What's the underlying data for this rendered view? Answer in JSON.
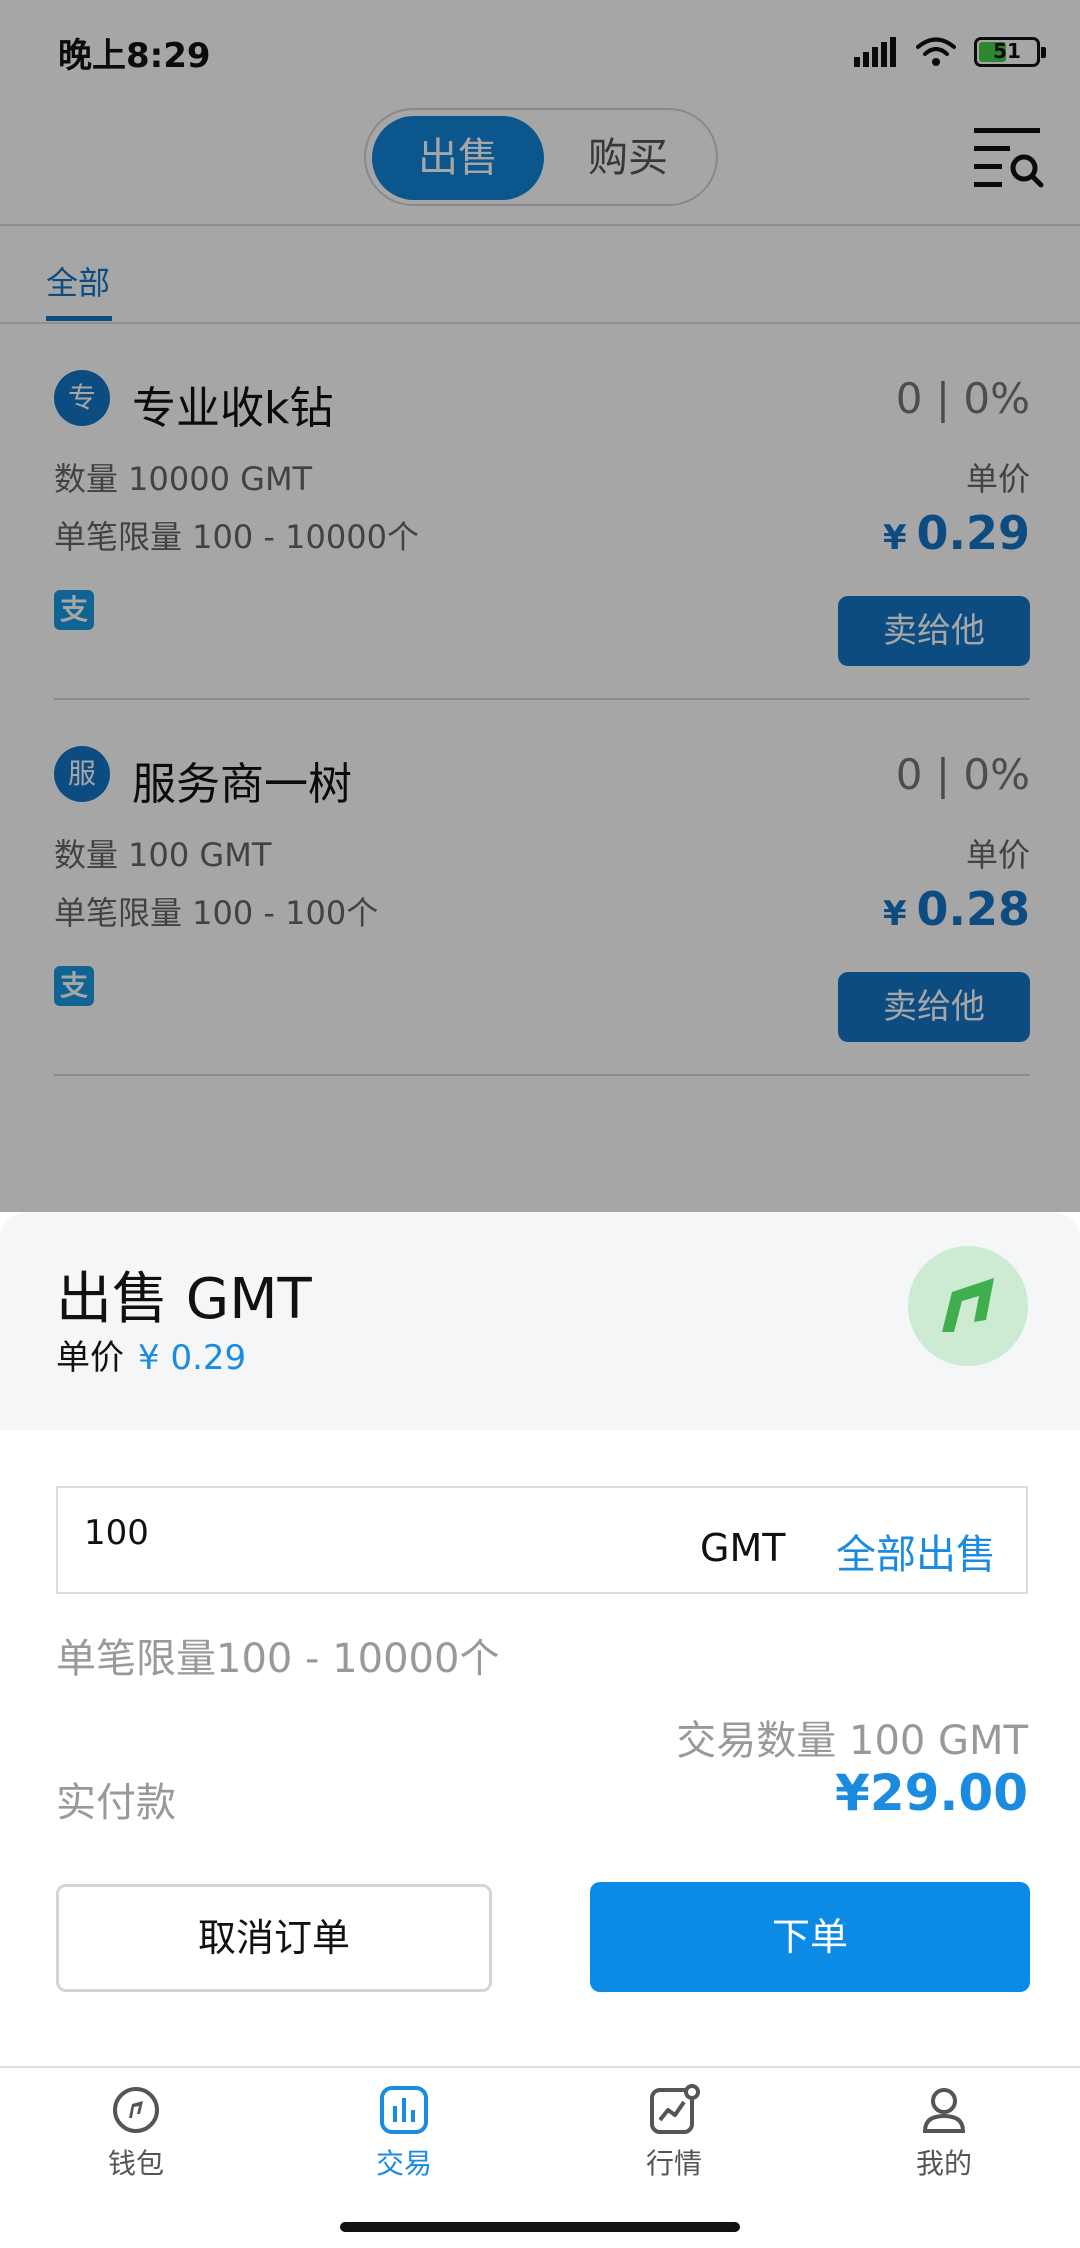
{
  "status_bar": {
    "time": "晚上8:29",
    "battery": "51",
    "battery_level": 0.51
  },
  "header": {
    "tabs": [
      "出售",
      "购买"
    ],
    "active_tab": "出售"
  },
  "filter_tabs": [
    "全部"
  ],
  "listings": [
    {
      "avatar": "专",
      "name": "专业收k钻",
      "stats": "0 | 0%",
      "quantity": "数量 10000 GMT",
      "limit": "单笔限量 100 - 10000个",
      "unit_label": "单价",
      "price_symbol": "¥",
      "price": "0.29",
      "payment_icon": "支",
      "action": "卖给他"
    },
    {
      "avatar": "服",
      "name": "服务商一树",
      "stats": "0 | 0%",
      "quantity": "数量 100 GMT",
      "limit": "单笔限量 100 - 100个",
      "unit_label": "单价",
      "price_symbol": "¥",
      "price": "0.28",
      "payment_icon": "支",
      "action": "卖给他"
    }
  ],
  "sheet": {
    "title": "出售 GMT",
    "unit_price_label": "单价",
    "unit_price": "¥ 0.29",
    "amount_value": "100",
    "amount_unit": "GMT",
    "sell_all": "全部出售",
    "limit_hint": "单笔限量100 - 10000个",
    "trade_qty": "交易数量 100 GMT",
    "pay_label": "实付款",
    "pay_amount": "¥29.00",
    "cancel": "取消订单",
    "submit": "下单"
  },
  "nav": {
    "items": [
      {
        "label": "钱包",
        "icon": "wallet-icon"
      },
      {
        "label": "交易",
        "icon": "trade-icon"
      },
      {
        "label": "行情",
        "icon": "market-icon"
      },
      {
        "label": "我的",
        "icon": "profile-icon"
      }
    ],
    "active": "交易"
  },
  "colors": {
    "accent": "#1476c7",
    "accent_light": "#1a8be0",
    "button": "#0b8be6",
    "battery_fill": "#46d04a",
    "coin_logo_bg": "#cdebd3",
    "coin_logo_mark": "#3fae4d"
  }
}
